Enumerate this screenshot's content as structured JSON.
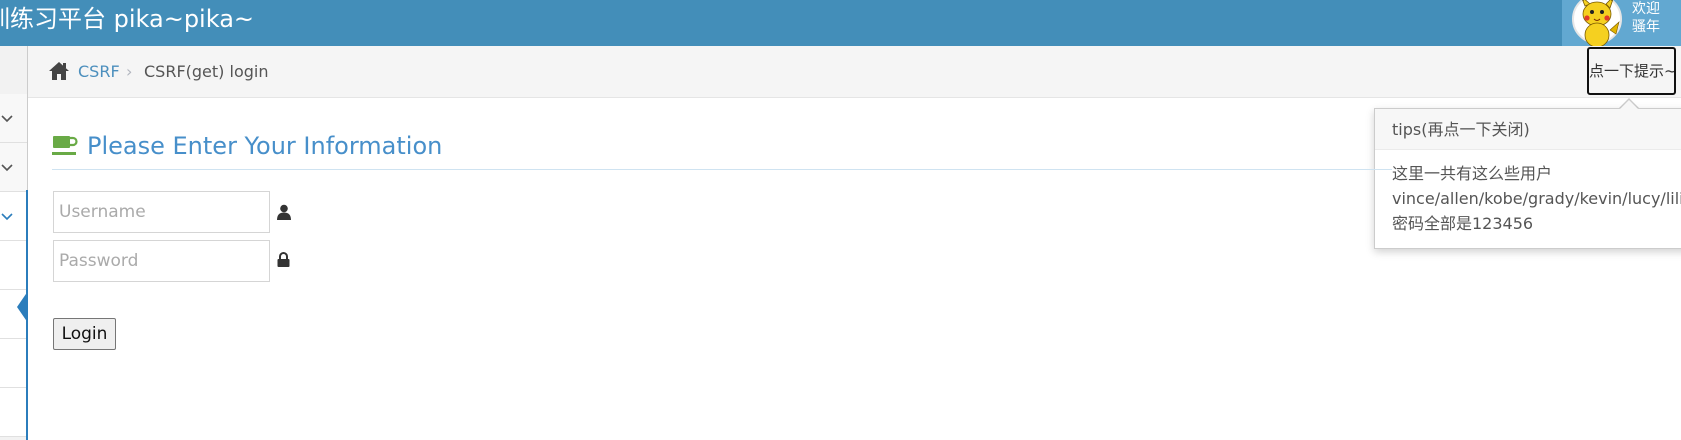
{
  "navbar": {
    "brand": "训练习平台 pika~pika~",
    "welcome_line1": "欢迎",
    "welcome_line2": "骚年",
    "avatar_icon": "pikachu-avatar"
  },
  "breadcrumb": {
    "home_icon": "home-icon",
    "parent": "CSRF",
    "separator": "›",
    "current": "CSRF(get) login"
  },
  "tip_button": {
    "label": "点一下提示~"
  },
  "popover": {
    "title": "tips(再点一下关闭)",
    "line1": "这里一共有这么些用户",
    "line2": "vince/allen/kobe/grady/kevin/lucy/lili,",
    "line3": "密码全部是123456"
  },
  "form": {
    "title": "Please Enter Your Information",
    "title_icon": "coffee-cup-icon",
    "username_placeholder": "Username",
    "username_icon": "user-icon",
    "password_placeholder": "Password",
    "password_icon": "lock-icon",
    "login_label": "Login"
  },
  "colors": {
    "navbar": "#438eb9",
    "user_box": "#62a8d1",
    "accent": "#478fca",
    "cup": "#69aa46"
  }
}
